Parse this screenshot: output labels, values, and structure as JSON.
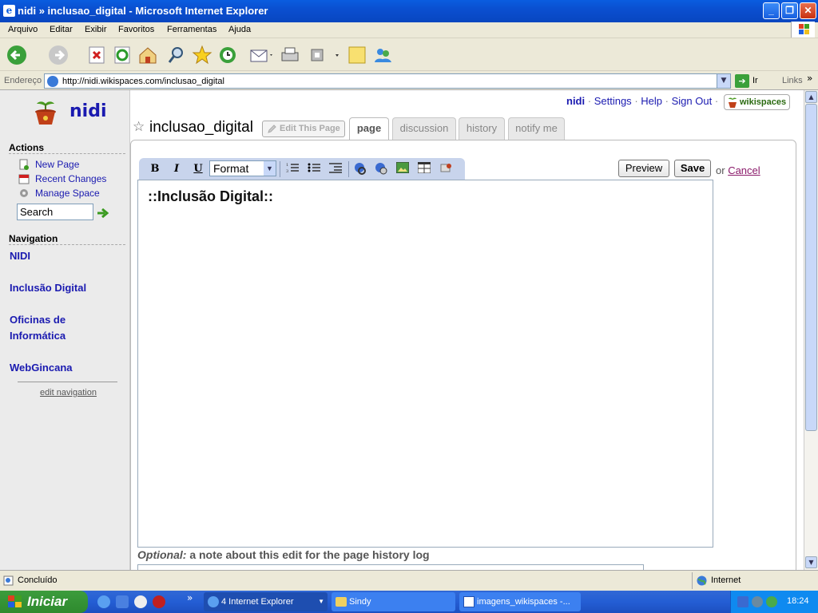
{
  "window": {
    "title": "nidi » inclusao_digital - Microsoft Internet Explorer"
  },
  "menu": [
    "Arquivo",
    "Editar",
    "Exibir",
    "Favoritos",
    "Ferramentas",
    "Ajuda"
  ],
  "address": {
    "label": "Endereço",
    "url": "http://nidi.wikispaces.com/inclusao_digital",
    "go": "Ir",
    "links": "Links"
  },
  "site": {
    "name": "nidi"
  },
  "toplinks": {
    "user": "nidi",
    "settings": "Settings",
    "help": "Help",
    "signout": "Sign Out",
    "sep": "·",
    "badge": "wikispaces"
  },
  "sidebar": {
    "actions_heading": "Actions",
    "actions": [
      {
        "label": "New Page",
        "icon": "new-page-icon"
      },
      {
        "label": "Recent Changes",
        "icon": "calendar-icon"
      },
      {
        "label": "Manage Space",
        "icon": "gear-icon"
      }
    ],
    "search_value": "Search",
    "navigation_heading": "Navigation",
    "nav": [
      "NIDI",
      "Inclusão Digital",
      "Oficinas de Informática",
      "WebGincana"
    ],
    "edit_navigation": "edit navigation"
  },
  "page": {
    "title": "inclusao_digital",
    "edit_this_page": "Edit This Page",
    "tabs": [
      "page",
      "discussion",
      "history",
      "notify me"
    ],
    "active_tab": "page"
  },
  "editor": {
    "format": "Format",
    "content": "::Inclusão Digital::",
    "preview": "Preview",
    "save": "Save",
    "or": "or",
    "cancel": "Cancel",
    "optional_label": "Optional:",
    "optional_text": "a note about this edit for the page history log"
  },
  "status": {
    "text": "Concluído",
    "zone": "Internet"
  },
  "taskbar": {
    "start": "Iniciar",
    "buttons": [
      "4 Internet Explorer",
      "Sindy",
      "imagens_wikispaces -..."
    ],
    "clock": "18:24"
  }
}
